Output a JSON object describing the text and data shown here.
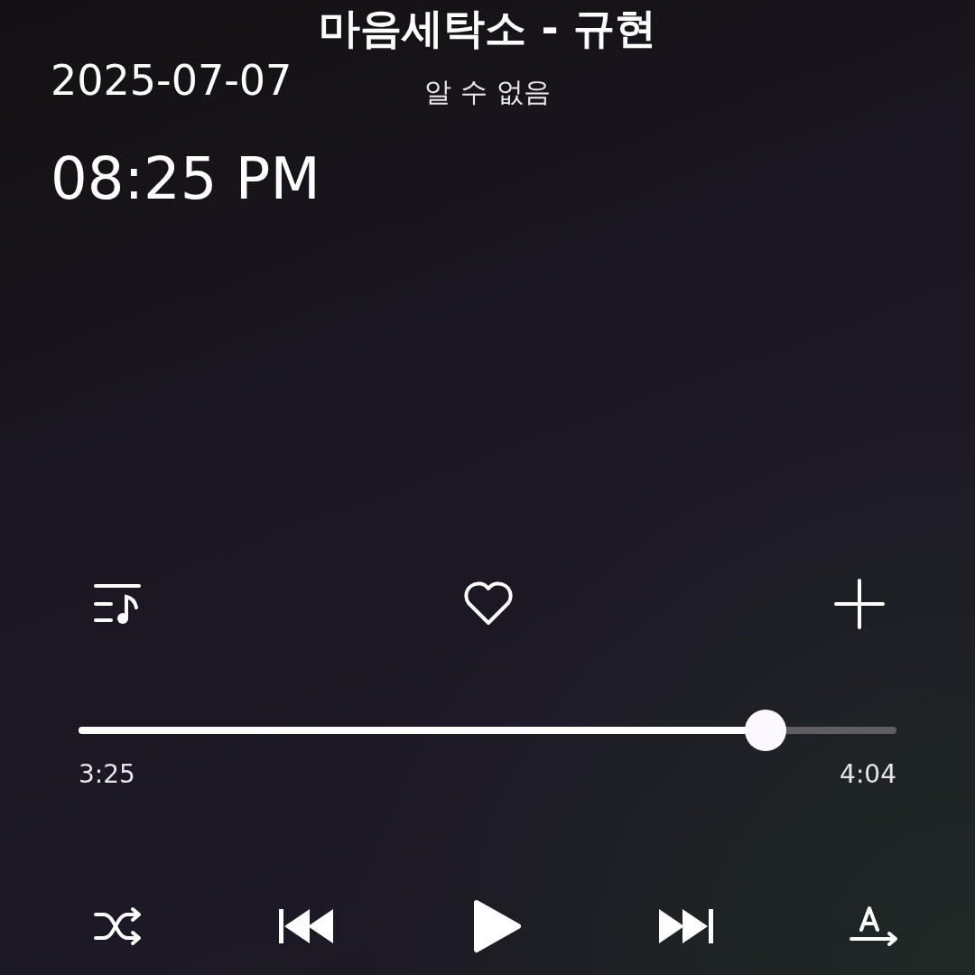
{
  "song": {
    "title": "마음세탁소 - 규현",
    "artist": "알 수 없음"
  },
  "stamp": {
    "date": "2025-07-07",
    "time": "08:25 PM"
  },
  "actions": {
    "liked": false
  },
  "progress": {
    "level": 0.84,
    "elapsed": "3:25",
    "total": "4:04"
  },
  "playback": {
    "playing": false
  }
}
